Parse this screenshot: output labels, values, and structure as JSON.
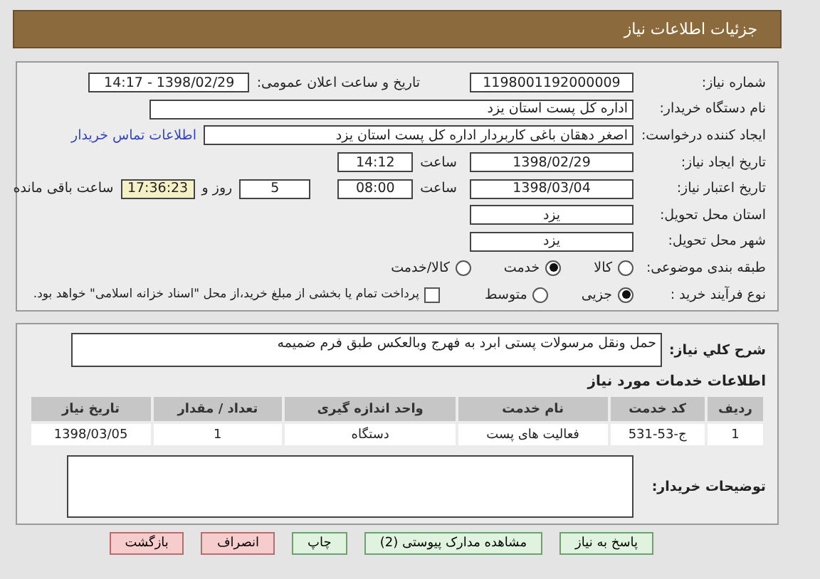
{
  "header": {
    "title": "جزئیات اطلاعات نیاز"
  },
  "need": {
    "number": {
      "label": "شماره نیاز:",
      "value": "1198001192000009"
    },
    "announce": {
      "label": "تاریخ و ساعت اعلان عمومی:",
      "value": "1398/02/29 - 14:17"
    },
    "buyer": {
      "label": "نام دستگاه خریدار:",
      "value": "اداره کل پست استان یزد"
    },
    "creator": {
      "label": "ایجاد کننده درخواست:",
      "value": "اصغر دهقان باغی کاربردار  اداره کل پست استان یزد",
      "link": "اطلاعات تماس خریدار"
    },
    "created": {
      "label": "تاریخ ایجاد نیاز:",
      "date": "1398/02/29",
      "time_label": "ساعت",
      "time": "14:12"
    },
    "valid": {
      "label": "تاریخ اعتبار نیاز:",
      "date": "1398/03/04",
      "time_label": "ساعت",
      "time": "08:00",
      "days": "5",
      "days_label": "روز و",
      "remaining": "17:36:23",
      "remaining_label": "ساعت باقی مانده"
    },
    "province": {
      "label": "استان محل تحویل:",
      "value": "یزد"
    },
    "city": {
      "label": "شهر محل تحویل:",
      "value": "یزد"
    },
    "category": {
      "label": "طبقه بندی موضوعی:",
      "options": [
        {
          "label": "کالا",
          "selected": false
        },
        {
          "label": "خدمت",
          "selected": true
        },
        {
          "label": "کالا/خدمت",
          "selected": false
        }
      ]
    },
    "process": {
      "label": "نوع فرآیند خرید :",
      "options": [
        {
          "label": "جزیی",
          "selected": true
        },
        {
          "label": "متوسط",
          "selected": false
        }
      ],
      "treasury": {
        "label": "پرداخت تمام یا بخشی از مبلغ خرید،از محل \"اسناد خزانه اسلامی\" خواهد بود.",
        "checked": false
      }
    }
  },
  "details": {
    "summary_label": "شرح کلي نیاز:",
    "summary": "حمل ونقل مرسولات پستی ابرد به فهرج وبالعکس طبق فرم ضمیمه",
    "services_title": "اطلاعات خدمات مورد نیاز",
    "table": {
      "columns": [
        "ردیف",
        "کد خدمت",
        "نام خدمت",
        "واحد اندازه گیری",
        "تعداد / مقدار",
        "تاریخ نیاز"
      ],
      "rows": [
        [
          "1",
          "ج-53-531",
          "فعالیت های پست",
          "دستگاه",
          "1",
          "1398/03/05"
        ]
      ]
    },
    "notes_label": "توضیحات خریدار:"
  },
  "buttons": [
    {
      "label": "پاسخ به نیاز",
      "kind": "green"
    },
    {
      "label": "مشاهده مدارک پیوستی (2)",
      "kind": "green"
    },
    {
      "label": "چاپ",
      "kind": "green"
    },
    {
      "label": "انصراف",
      "kind": "red"
    },
    {
      "label": "بازگشت",
      "kind": "red"
    }
  ]
}
